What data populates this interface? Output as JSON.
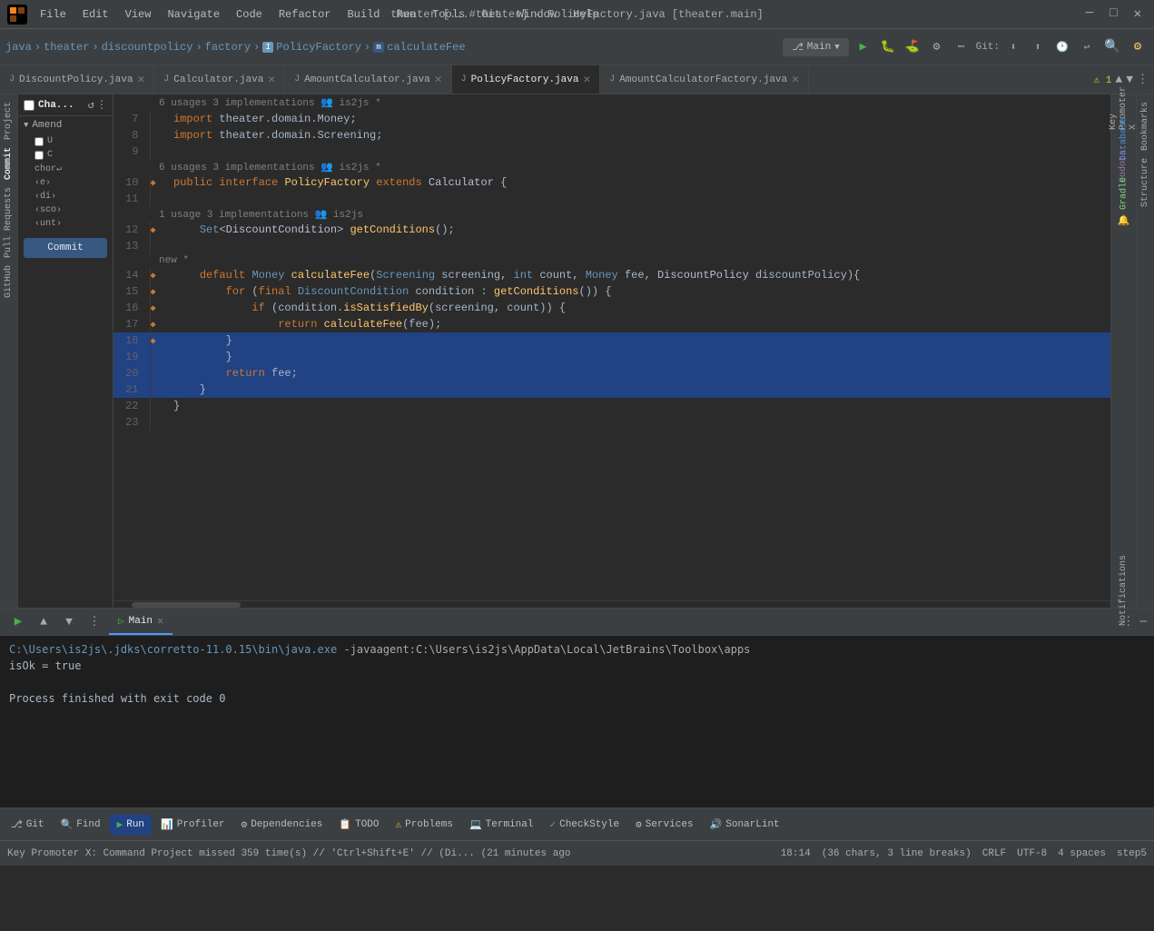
{
  "titleBar": {
    "title": "theater [...#theater] - PolicyFactory.java [theater.main]",
    "menuItems": [
      "File",
      "Edit",
      "View",
      "Navigate",
      "Code",
      "Refactor",
      "Build",
      "Run",
      "Tools",
      "Git",
      "Window",
      "Help"
    ]
  },
  "toolbar": {
    "breadcrumb": [
      "java",
      "theater",
      "discountpolicy",
      "factory",
      "PolicyFactory",
      "calculateFee"
    ],
    "branch": "Main",
    "gitLabel": "Git:"
  },
  "tabs": [
    {
      "label": "DiscountPolicy.java",
      "icon": "J",
      "active": false
    },
    {
      "label": "Calculator.java",
      "icon": "J",
      "active": false
    },
    {
      "label": "AmountCalculator.java",
      "icon": "J",
      "active": false
    },
    {
      "label": "PolicyFactory.java",
      "icon": "J",
      "active": true
    },
    {
      "label": "AmountCalculatorFactory.java",
      "icon": "J",
      "active": false
    }
  ],
  "sidebar": {
    "title": "Cha...",
    "sections": {
      "label": "Amend",
      "items": [
        "chor↵",
        "‹e›",
        "‹di›",
        "‹sco›",
        "‹unt›"
      ]
    },
    "commitBtn": "Commit"
  },
  "editor": {
    "infoBar1": "6 usages   3 implementations   👥 is2js *",
    "infoBar2": "1 usage   3 implementations   👥 is2js",
    "infoBarNew": "new *",
    "lines": [
      {
        "num": 7,
        "content": "import theater.domain.Money;"
      },
      {
        "num": 8,
        "content": "import theater.domain.Screening;"
      },
      {
        "num": 9,
        "content": ""
      },
      {
        "num": 10,
        "content": "public interface PolicyFactory extends Calculator {"
      },
      {
        "num": 11,
        "content": ""
      },
      {
        "num": 12,
        "content": "    Set<DiscountCondition> getConditions();"
      },
      {
        "num": 13,
        "content": ""
      },
      {
        "num": 14,
        "content": "    default Money calculateFee(Screening screening, int count, Money fee, DiscountPolicy discountPolicy){"
      },
      {
        "num": 15,
        "content": "        for (final DiscountCondition condition : getConditions()) {"
      },
      {
        "num": 16,
        "content": "            if (condition.isSatisfiedBy(screening, count)) {"
      },
      {
        "num": 17,
        "content": "                return calculateFee(fee);"
      },
      {
        "num": 18,
        "content": "        }"
      },
      {
        "num": 19,
        "content": "        }"
      },
      {
        "num": 20,
        "content": "        return fee;"
      },
      {
        "num": 21,
        "content": "    }"
      },
      {
        "num": 22,
        "content": "}"
      },
      {
        "num": 23,
        "content": ""
      }
    ]
  },
  "terminal": {
    "tabs": [
      {
        "label": "Main",
        "active": true
      }
    ],
    "path": "C:\\Users\\is2js\\.jdks\\corretto-11.0.15\\bin\\java.exe",
    "pathSuffix": " -javaagent:C:\\Users\\is2js\\AppData\\Local\\JetBrains\\Toolbox\\apps",
    "line2": "isOk = true",
    "line3": "",
    "line4": "Process finished with exit code 0"
  },
  "bottomBar": {
    "tools": [
      {
        "icon": "⎇",
        "label": "Git"
      },
      {
        "icon": "🔍",
        "label": "Find"
      },
      {
        "icon": "▶",
        "label": "Run",
        "active": true
      },
      {
        "icon": "📊",
        "label": "Profiler"
      },
      {
        "icon": "⚙",
        "label": "Dependencies"
      },
      {
        "icon": "📋",
        "label": "TODO"
      },
      {
        "icon": "⚠",
        "label": "Problems"
      },
      {
        "icon": "💻",
        "label": "Terminal"
      },
      {
        "icon": "✓",
        "label": "CheckStyle"
      },
      {
        "icon": "⚙",
        "label": "Services"
      },
      {
        "icon": "🔊",
        "label": "SonarLint"
      }
    ]
  },
  "statusBar": {
    "keyPromoterMsg": "Key Promoter X: Command Project missed 359 time(s) // 'Ctrl+Shift+E' // (Di... (21 minutes ago",
    "position": "18:14",
    "chars": "(36 chars, 3 line breaks)",
    "lineEnding": "CRLF",
    "encoding": "UTF-8",
    "indent": "4 spaces",
    "step": "step5",
    "warningCount": "1"
  },
  "rightBar": {
    "labels": [
      "Key Promoter X",
      "Database",
      "Codota",
      "Gradle",
      "Notifications"
    ]
  },
  "leftSideLabels": [
    "Project",
    "Commit",
    "Pull Requests",
    "GitHub"
  ],
  "bookmarksLabel": "Bookmarks",
  "structureLabel": "Structure"
}
